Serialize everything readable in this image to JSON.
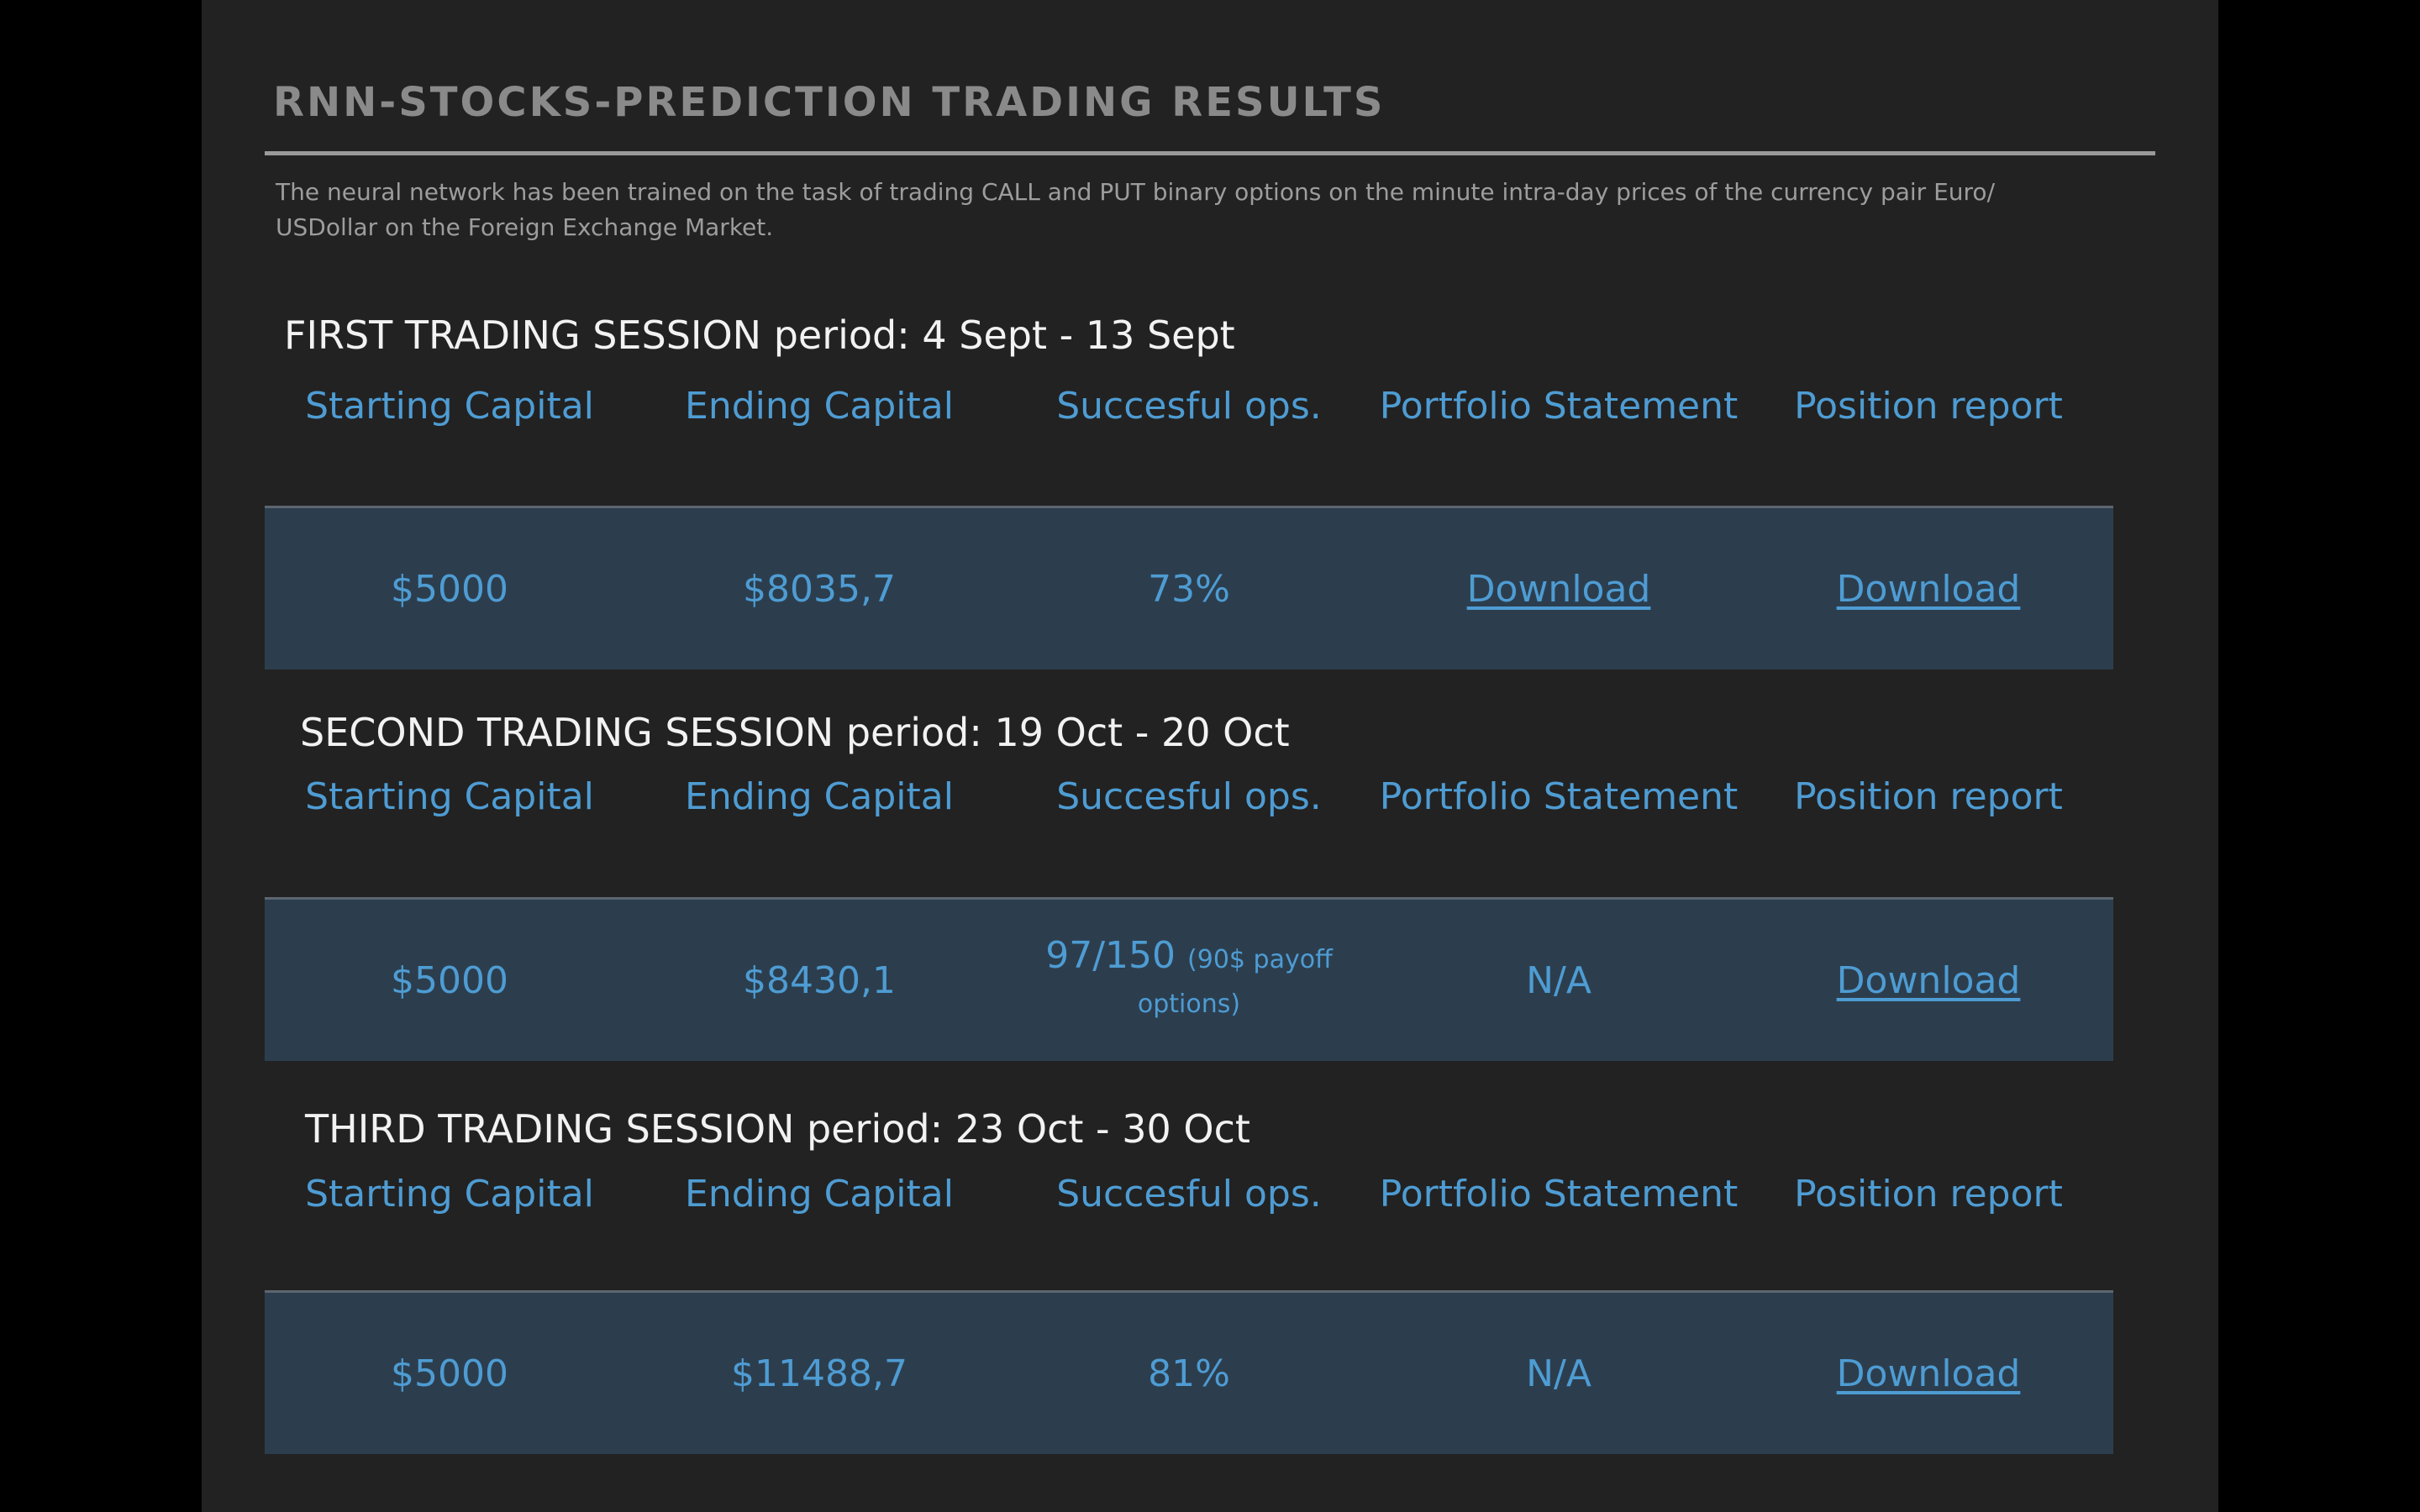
{
  "page": {
    "title": "RNN-STOCKS-PREDICTION TRADING RESULTS",
    "description": "The neural network has been trained on the task of trading CALL and PUT binary options on the minute intra-day prices of the currency pair Euro/ USDollar on the Foreign Exchange Market."
  },
  "columns": [
    "Starting Capital",
    "Ending Capital",
    "Succesful ops.",
    "Portfolio Statement",
    "Position report"
  ],
  "sessions": [
    {
      "heading": "FIRST TRADING SESSION  period: 4 Sept - 13 Sept",
      "starting_capital": "$5000",
      "ending_capital": "$8035,7",
      "successful_ops": "73%",
      "successful_ops_note": "",
      "portfolio_statement": "Download",
      "position_report": "Download"
    },
    {
      "heading": "SECOND TRADING SESSION  period: 19 Oct - 20 Oct",
      "starting_capital": "$5000",
      "ending_capital": "$8430,1",
      "successful_ops": "97/150",
      "successful_ops_note": "(90$ payoff options)",
      "portfolio_statement": "N/A",
      "position_report": "Download"
    },
    {
      "heading": "THIRD TRADING SESSION  period: 23 Oct - 30 Oct",
      "starting_capital": "$5000",
      "ending_capital": "$11488,7",
      "successful_ops": "81%",
      "successful_ops_note": "",
      "portfolio_statement": "N/A",
      "position_report": "Download"
    }
  ],
  "colors": {
    "background": "#000000",
    "panel": "#222222",
    "accent": "#4e9cd3",
    "data_row": "#2c3e4e",
    "heading_text": "#f2f2f2",
    "title_text": "#8a8a8a"
  }
}
